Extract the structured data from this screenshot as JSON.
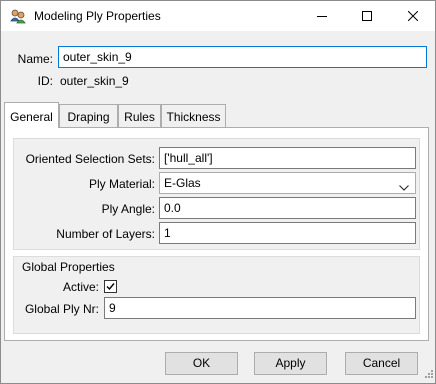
{
  "window": {
    "title": "Modeling Ply Properties"
  },
  "header": {
    "name_label": "Name:",
    "name_value": "outer_skin_9",
    "id_label": "ID:",
    "id_value": "outer_skin_9"
  },
  "tabs": [
    {
      "label": "General"
    },
    {
      "label": "Draping"
    },
    {
      "label": "Rules"
    },
    {
      "label": "Thickness"
    }
  ],
  "general": {
    "oss_label": "Oriented Selection Sets:",
    "oss_value": "['hull_all']",
    "material_label": "Ply Material:",
    "material_value": "E-Glas",
    "angle_label": "Ply Angle:",
    "angle_value": "0.0",
    "layers_label": "Number of Layers:",
    "layers_value": "1"
  },
  "global_properties": {
    "title": "Global Properties",
    "active_label": "Active:",
    "active_checked": true,
    "ply_nr_label": "Global Ply Nr:",
    "ply_nr_value": "9"
  },
  "buttons": {
    "ok": "OK",
    "apply": "Apply",
    "cancel": "Cancel"
  }
}
